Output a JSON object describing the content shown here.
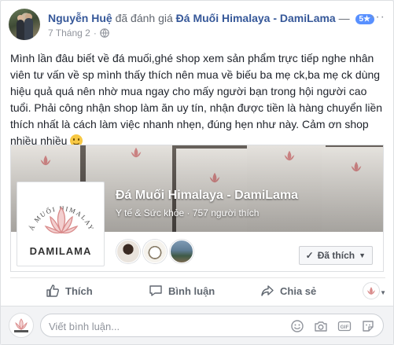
{
  "post": {
    "author": "Nguyễn Huệ",
    "verb": "đã đánh giá",
    "page_name": "Đá Muối Himalaya - DamiLama",
    "dash": "—",
    "rating": "5★",
    "date": "7 Tháng 2",
    "more": "···",
    "text": "Mình lần đâu biết về đá muối,ghé shop xem sản phẩm trực tiếp nghe nhân viên tư vấn về sp mình thấy thích nên mua về biếu ba mẹ ck,ba mẹ ck dùng hiệu quả quá nên nhờ mua ngay cho mấy người bạn trong hội người cao tuổi. Phải công nhận shop làm ăn uy tín, nhận được tiền là hàng chuyển liền thích nhất là cách làm việc nhanh nhẹn, đúng hẹn như này. Cảm ơn shop nhiều nhiều "
  },
  "page_card": {
    "title": "Đá Muối Himalaya - DamiLama",
    "meta": "Y tế & Sức khỏe · 757 người thích",
    "logo_text": "DAMILAMA",
    "logo_arc": "ĐÁ MUỐI HIMALAYA",
    "liked_label": "Đã thích"
  },
  "actions": {
    "like": "Thích",
    "comment": "Bình luận",
    "share": "Chia sẻ"
  },
  "comment": {
    "placeholder": "Viết bình luận..."
  },
  "colors": {
    "link": "#365899",
    "badge": "#5890ff",
    "accent_logo": "#d98b8b"
  }
}
